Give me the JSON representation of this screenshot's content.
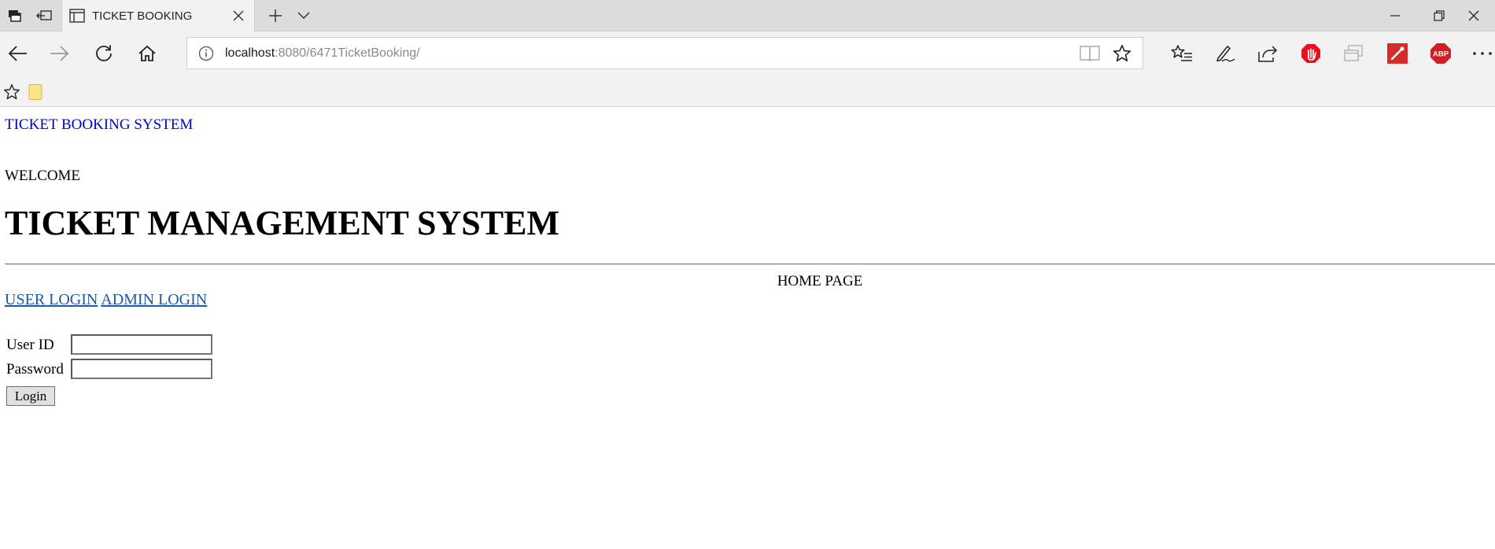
{
  "browser": {
    "tab": {
      "title": "TICKET BOOKING"
    },
    "address": {
      "host": "localhost",
      "path": ":8080/6471TicketBooking/"
    }
  },
  "page": {
    "site_title": "TICKET BOOKING SYSTEM",
    "welcome": "WELCOME",
    "heading": "TICKET MANAGEMENT SYSTEM",
    "home_page": "HOME PAGE",
    "links": {
      "user_login": "USER LOGIN",
      "admin_login": "ADMIN LOGIN"
    },
    "form": {
      "user_id_label": "User ID",
      "user_id_value": "",
      "password_label": "Password",
      "password_value": "",
      "login_button": "Login"
    }
  },
  "icons": {
    "stop_extension": "#e81123",
    "lastpass": "#d32d27",
    "adblock": "#cf1f25"
  }
}
